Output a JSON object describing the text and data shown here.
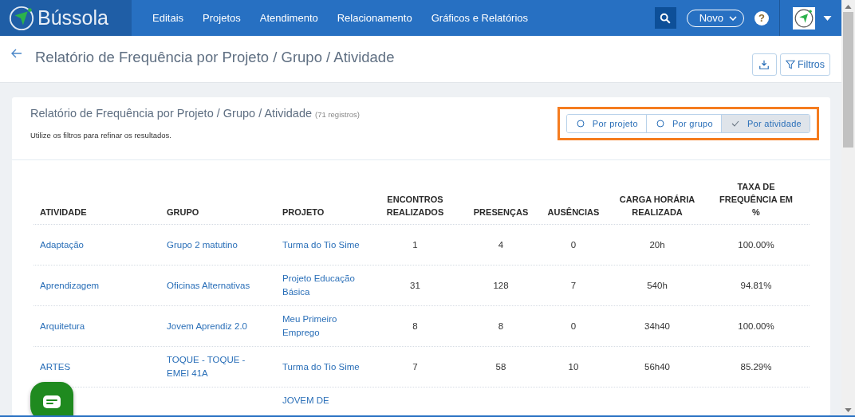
{
  "brand": "Bússola",
  "nav": [
    "Editais",
    "Projetos",
    "Atendimento",
    "Relacionamento",
    "Gráficos e Relatórios"
  ],
  "new_button": "Novo",
  "help": "?",
  "page_title": "Relatório de Frequência por Projeto / Grupo / Atividade",
  "filter_button": "Filtros",
  "report": {
    "title": "Relatório de Frequência por Projeto / Grupo / Atividade",
    "count": "(71 registros)",
    "hint": "Utilize os filtros para refinar os resultados."
  },
  "view_options": [
    {
      "label": "Por projeto",
      "selected": false
    },
    {
      "label": "Por grupo",
      "selected": false
    },
    {
      "label": "Por atividade",
      "selected": true
    }
  ],
  "table": {
    "columns": [
      "ATIVIDADE",
      "GRUPO",
      "PROJETO",
      "ENCONTROS REALIZADOS",
      "PRESENÇAS",
      "AUSÊNCIAS",
      "CARGA HORÁRIA REALIZADA",
      "TAXA DE FREQUÊNCIA EM %"
    ],
    "rows": [
      {
        "atividade": "Adaptação",
        "grupo": "Grupo 2 matutino",
        "grupo_link": true,
        "projeto": "Turma do Tio Sime",
        "encontros": "1",
        "presencas": "4",
        "ausencias": "0",
        "carga": "20h",
        "taxa": "100.00%"
      },
      {
        "atividade": "Aprendizagem",
        "grupo": "Oficinas Alternativas",
        "grupo_link": true,
        "projeto": "Projeto Educação Básica",
        "encontros": "31",
        "presencas": "128",
        "ausencias": "7",
        "carga": "540h",
        "taxa": "94.81%"
      },
      {
        "atividade": "Arquitetura",
        "grupo": "Jovem Aprendiz 2.0",
        "grupo_link": true,
        "projeto": "Meu Primeiro Emprego",
        "encontros": "8",
        "presencas": "8",
        "ausencias": "0",
        "carga": "34h40",
        "taxa": "100.00%"
      },
      {
        "atividade": "ARTES",
        "grupo": "TOQUE - TOQUE - EMEI 41A",
        "grupo_link": true,
        "projeto": "Turma do Tio Sime",
        "encontros": "7",
        "presencas": "58",
        "ausencias": "10",
        "carga": "56h40",
        "taxa": "85.29%"
      },
      {
        "projeto": "JOVEM DE"
      }
    ]
  }
}
